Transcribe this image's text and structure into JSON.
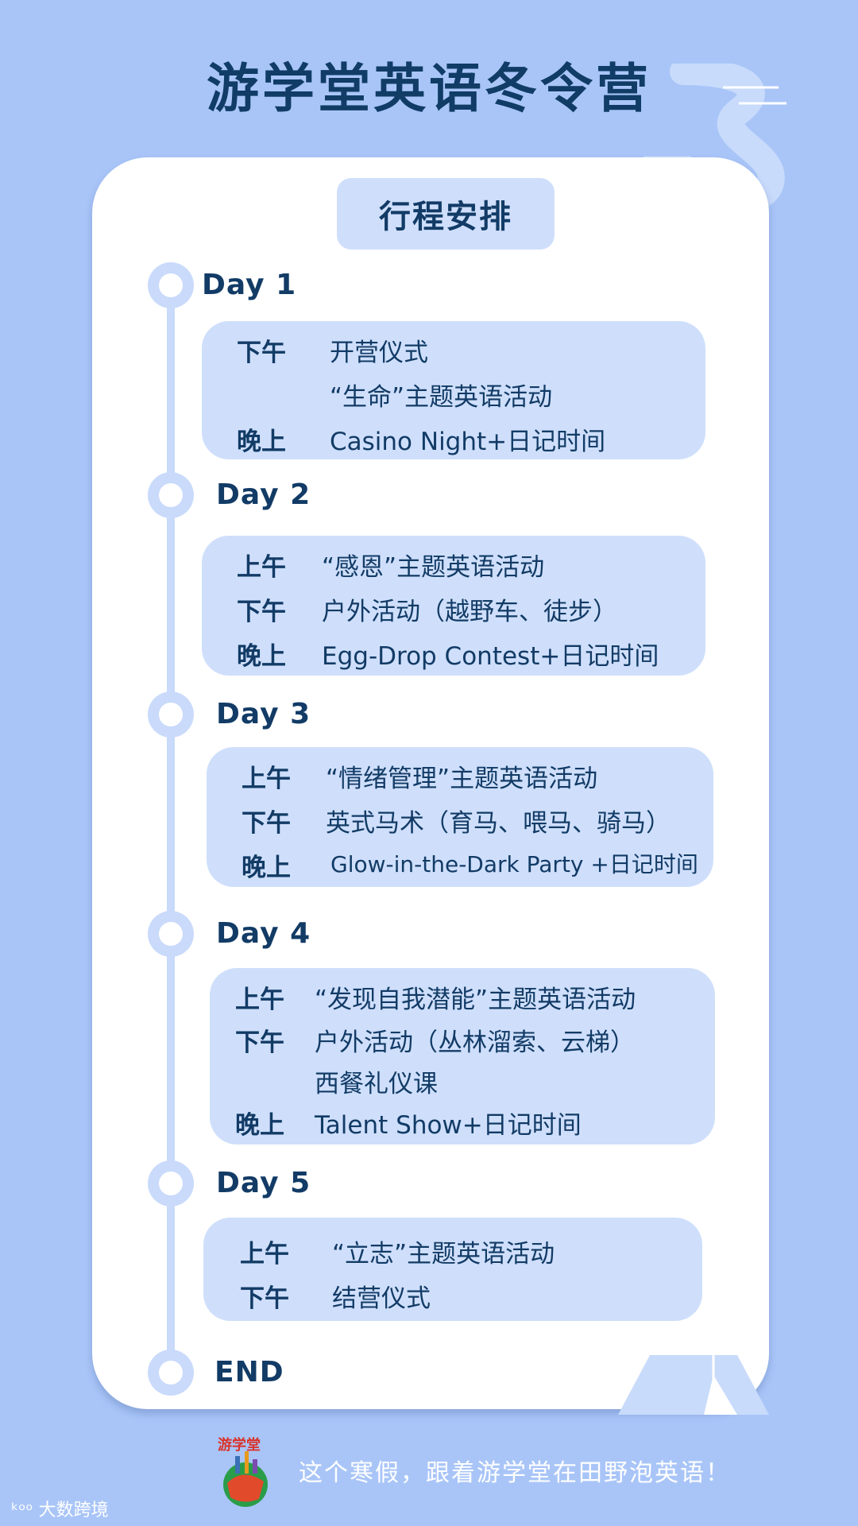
{
  "title": "游学堂英语冬令营",
  "schedule_header": "行程安排",
  "days": [
    {
      "label": "Day 1",
      "rows": [
        {
          "time": "下午",
          "activity": "开营仪式"
        },
        {
          "time": "",
          "activity": "“生命”主题英语活动"
        },
        {
          "time": "晚上",
          "activity": "Casino Night+日记时间"
        }
      ]
    },
    {
      "label": "Day 2",
      "rows": [
        {
          "time": "上午",
          "activity": "“感恩”主题英语活动"
        },
        {
          "time": "下午",
          "activity": "户外活动（越野车、徒步）"
        },
        {
          "time": "晚上",
          "activity": "Egg-Drop Contest+日记时间"
        }
      ]
    },
    {
      "label": "Day 3",
      "rows": [
        {
          "time": "上午",
          "activity": "“情绪管理”主题英语活动"
        },
        {
          "time": "下午",
          "activity": "英式马术（育马、喂马、骑马）"
        },
        {
          "time": "晚上",
          "activity": "Glow-in-the-Dark Party +日记时间"
        }
      ]
    },
    {
      "label": "Day 4",
      "rows": [
        {
          "time": "上午",
          "activity": "“发现自我潜能”主题英语活动"
        },
        {
          "time": "下午",
          "activity": "户外活动（丛林溜索、云梯）"
        },
        {
          "time": "",
          "activity": "西餐礼仪课"
        },
        {
          "time": "晚上",
          "activity": "Talent Show+日记时间"
        }
      ]
    },
    {
      "label": "Day 5",
      "rows": [
        {
          "time": "上午",
          "activity": "“立志”主题英语活动"
        },
        {
          "time": "下午",
          "activity": "结营仪式"
        }
      ]
    }
  ],
  "end_label": "END",
  "footer": {
    "slogan": "这个寒假，跟着游学堂在田野泡英语！",
    "logo_text": "游学堂",
    "watermark": "大数跨境"
  },
  "colors": {
    "background": "#a9c5f8",
    "card": "#ffffff",
    "box": "#cfdffb",
    "text": "#123b66"
  }
}
